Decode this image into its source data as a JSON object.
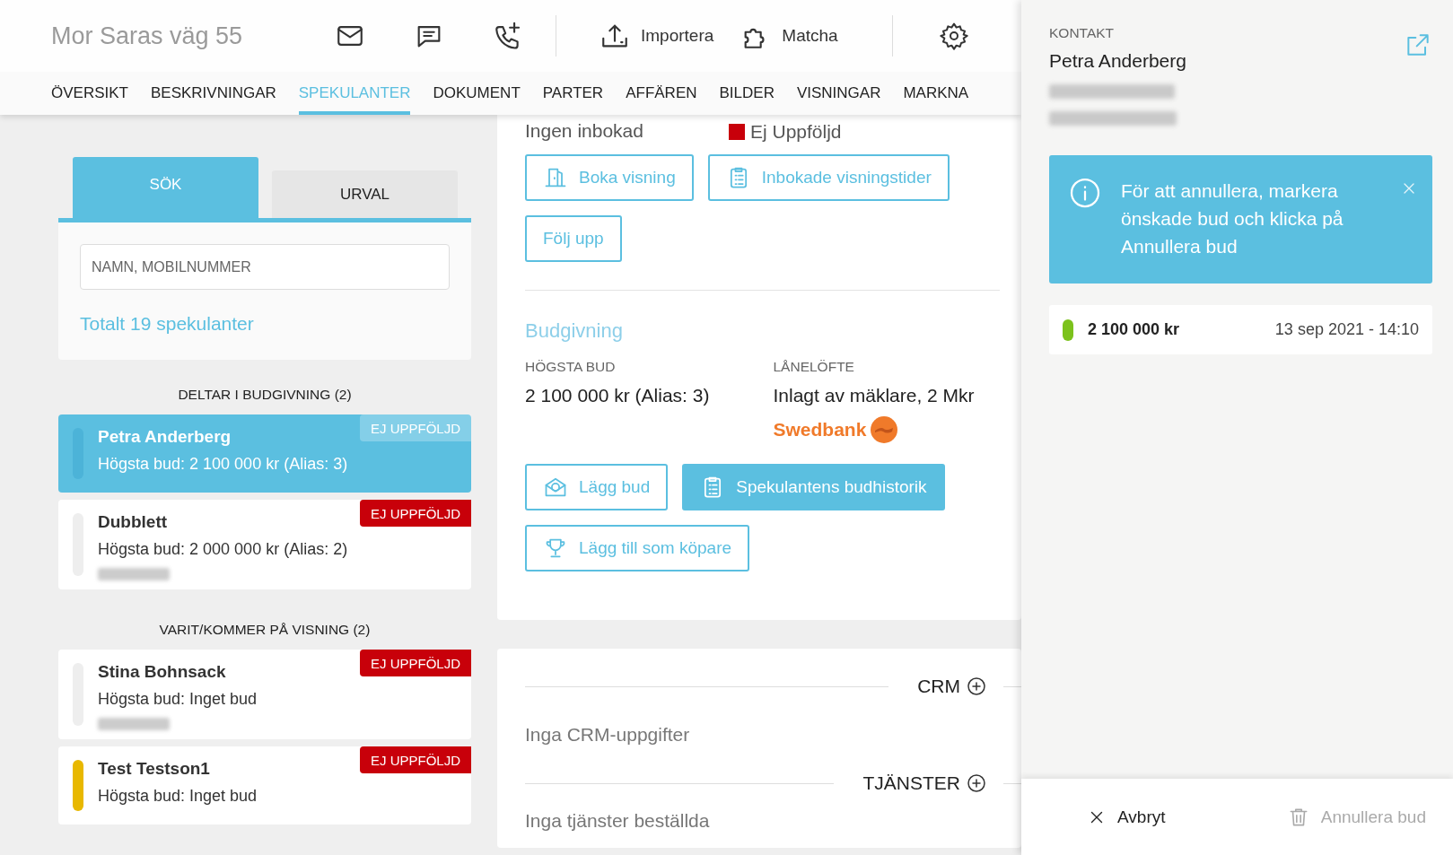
{
  "header": {
    "title": "Mor Saras väg 55",
    "actions": [
      {
        "label": "Importera"
      },
      {
        "label": "Matcha"
      }
    ]
  },
  "nav_tabs": [
    {
      "label": "ÖVERSIKT",
      "selected": false
    },
    {
      "label": "BESKRIVNINGAR",
      "selected": false
    },
    {
      "label": "SPEKULANTER",
      "selected": true
    },
    {
      "label": "DOKUMENT",
      "selected": false
    },
    {
      "label": "PARTER",
      "selected": false
    },
    {
      "label": "AFFÄREN",
      "selected": false
    },
    {
      "label": "BILDER",
      "selected": false
    },
    {
      "label": "VISNINGAR",
      "selected": false
    },
    {
      "label": "MARKNA",
      "selected": false
    }
  ],
  "search_panel": {
    "tabs": [
      {
        "label": "SÖK",
        "selected": true
      },
      {
        "label": "URVAL",
        "selected": false
      }
    ],
    "placeholder": "NAMN, MOBILNUMMER",
    "total": "Totalt 19 spekulanter"
  },
  "groups": [
    {
      "heading": "DELTAR I BUDGIVNING (2)",
      "items": [
        {
          "name": "Petra Anderberg",
          "bid": "Högsta bud: 2 100 000 kr (Alias: 3)",
          "status": "EJ UPPFÖLJD",
          "selected": true,
          "phone_redacted": false,
          "color": "#4cb3d8"
        },
        {
          "name": "Dubblett",
          "bid": "Högsta bud: 2 000 000 kr (Alias: 2)",
          "status": "EJ UPPFÖLJD",
          "selected": false,
          "phone_redacted": true,
          "color": "#eeeeee"
        }
      ]
    },
    {
      "heading": "VARIT/KOMMER PÅ VISNING (2)",
      "items": [
        {
          "name": "Stina Bohnsack",
          "bid": "Högsta bud: Inget bud",
          "status": "EJ UPPFÖLJD",
          "selected": false,
          "phone_redacted": true,
          "color": "#eeeeee"
        },
        {
          "name": "Test Testson1",
          "bid": "Högsta bud: Inget bud",
          "status": "EJ UPPFÖLJD",
          "selected": false,
          "phone_redacted": false,
          "color": "#e8b800"
        }
      ]
    }
  ],
  "showings": {
    "next_value": "Ingen inbokad",
    "previous_value": "Ej Uppföljd",
    "buttons": [
      {
        "label": "Boka visning"
      },
      {
        "label": "Inbokade visningstider"
      },
      {
        "label": "Följ upp"
      }
    ]
  },
  "bidding": {
    "title": "Budgivning",
    "highest_bid_label": "HÖGSTA BUD",
    "highest_bid": "2 100 000 kr (Alias: 3)",
    "loan_label": "LÅNELÖFTE",
    "loan_value": "Inlagt av mäklare, 2 Mkr",
    "bank": "Swedbank",
    "buttons": [
      {
        "label": "Lägg bud",
        "primary": false
      },
      {
        "label": "Spekulantens budhistorik",
        "primary": true
      },
      {
        "label": "Lägg till som köpare",
        "primary": false
      }
    ]
  },
  "crm": {
    "title": "CRM",
    "empty": "Inga CRM-uppgifter"
  },
  "services": {
    "title": "TJÄNSTER",
    "empty": "Inga tjänster beställda"
  },
  "contact": {
    "label": "KONTAKT",
    "name": "Petra Anderberg",
    "address_redacted": true,
    "info": "För att annullera, markera önskade bud och klicka på Annullera bud",
    "bids": [
      {
        "amount": "2 100 000 kr",
        "date": "13 sep 2021 - 14:10",
        "color": "#7cc21c"
      }
    ],
    "footer": [
      {
        "label": "Avbryt",
        "disabled": false
      },
      {
        "label": "Annullera bud",
        "disabled": true
      }
    ]
  }
}
